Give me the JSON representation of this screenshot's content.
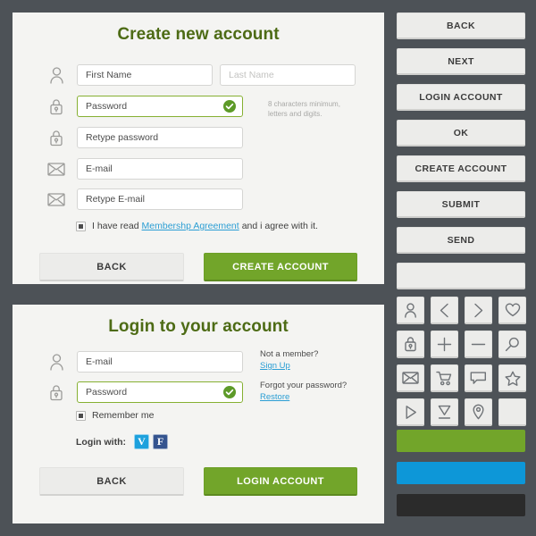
{
  "theme": {
    "background": "#4d5257",
    "panel_background": "#f4f4f2",
    "heading_color": "#4d6b15",
    "accent_green": "#72a52a",
    "accent_blue": "#2b9ed4",
    "dark": "#2b2b2b"
  },
  "signup": {
    "title": "Create new account",
    "fields": {
      "first_name": {
        "value": "First Name",
        "icon": "user-icon"
      },
      "last_name": {
        "placeholder": "Last Name",
        "icon": "none"
      },
      "password": {
        "value": "Password",
        "icon": "lock-icon",
        "valid": true
      },
      "retype_password": {
        "value": "Retype password",
        "icon": "lock-icon"
      },
      "email": {
        "value": "E-mail",
        "icon": "envelope-icon"
      },
      "retype_email": {
        "value": "Retype E-mail",
        "icon": "envelope-icon"
      }
    },
    "password_hint": "8 characters minimum, letters and digits.",
    "agreement": {
      "prefix": "I have read",
      "link": "Membershp Agreement",
      "suffix": "and i agree with it.",
      "checked": true
    },
    "buttons": {
      "back": "BACK",
      "create": "CREATE ACCOUNT"
    }
  },
  "login": {
    "title": "Login to your account",
    "fields": {
      "email": {
        "value": "E-mail",
        "icon": "user-icon"
      },
      "password": {
        "value": "Password",
        "icon": "lock-icon",
        "valid": true
      }
    },
    "notes": {
      "not_member": "Not a member?",
      "sign_up": "Sign Up",
      "forgot": "Forgot your password?",
      "restore": "Restore"
    },
    "remember_me": {
      "label": "Remember me",
      "checked": true
    },
    "social": {
      "label": "Login with:",
      "providers": [
        {
          "name": "vk",
          "glyph": "V",
          "color": "#1da1dd"
        },
        {
          "name": "facebook",
          "glyph": "F",
          "color": "#35548f"
        }
      ]
    },
    "buttons": {
      "back": "BACK",
      "login": "LOGIN ACCOUNT"
    }
  },
  "rail": {
    "buttons": [
      "BACK",
      "NEXT",
      "LOGIN ACCOUNT",
      "OK",
      "CREATE ACCOUNT",
      "SUBMIT",
      "SEND",
      ""
    ],
    "icons": [
      "user-icon",
      "chevron-left-icon",
      "chevron-right-icon",
      "heart-icon",
      "lock-icon",
      "plus-icon",
      "minus-icon",
      "search-icon",
      "envelope-icon",
      "cart-icon",
      "chat-icon",
      "star-icon",
      "play-icon",
      "download-icon",
      "pin-icon",
      "blank-icon"
    ],
    "swatches": [
      {
        "name": "green",
        "color": "#72a52a"
      },
      {
        "name": "blue",
        "color": "#0d97d8"
      },
      {
        "name": "dark",
        "color": "#2b2b2b"
      }
    ]
  }
}
